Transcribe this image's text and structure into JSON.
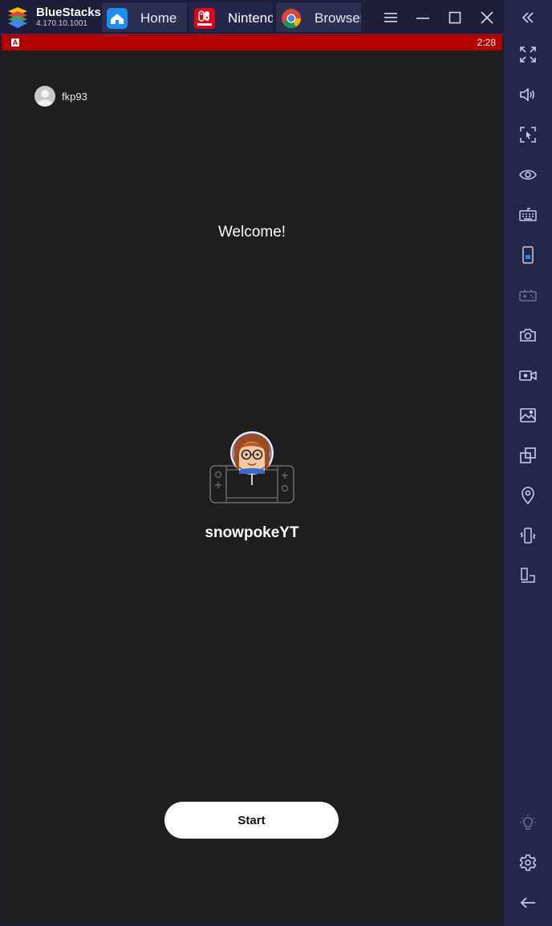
{
  "app": {
    "name": "BlueStacks",
    "version": "4.170.10.1001"
  },
  "tabs": [
    {
      "label": "Home",
      "icon": "home-icon"
    },
    {
      "label": "Nintendo Switch Online",
      "icon": "nintendo-switch-online-icon"
    },
    {
      "label": "Browser",
      "icon": "chrome-icon"
    }
  ],
  "window_controls": [
    "menu-icon",
    "minimize-icon",
    "maximize-icon",
    "close-icon",
    "collapse-sidebar-icon"
  ],
  "status_bar": {
    "time": "2:28",
    "color": "#b40000"
  },
  "account": {
    "username": "fkp93"
  },
  "main": {
    "welcome": "Welcome!",
    "mii_name": "snowpokeYT",
    "start_label": "Start"
  },
  "sidebar_icons": [
    "fullscreen-icon",
    "volume-icon",
    "lock-cursor-icon",
    "eye-icon",
    "keyboard-icon",
    "phone-rotate-icon",
    "gamepad-icon",
    "camera-icon",
    "record-video-icon",
    "media-icon",
    "multi-instance-icon",
    "location-icon",
    "shake-icon",
    "resize-icon",
    "bulb-icon",
    "settings-icon",
    "back-icon"
  ]
}
